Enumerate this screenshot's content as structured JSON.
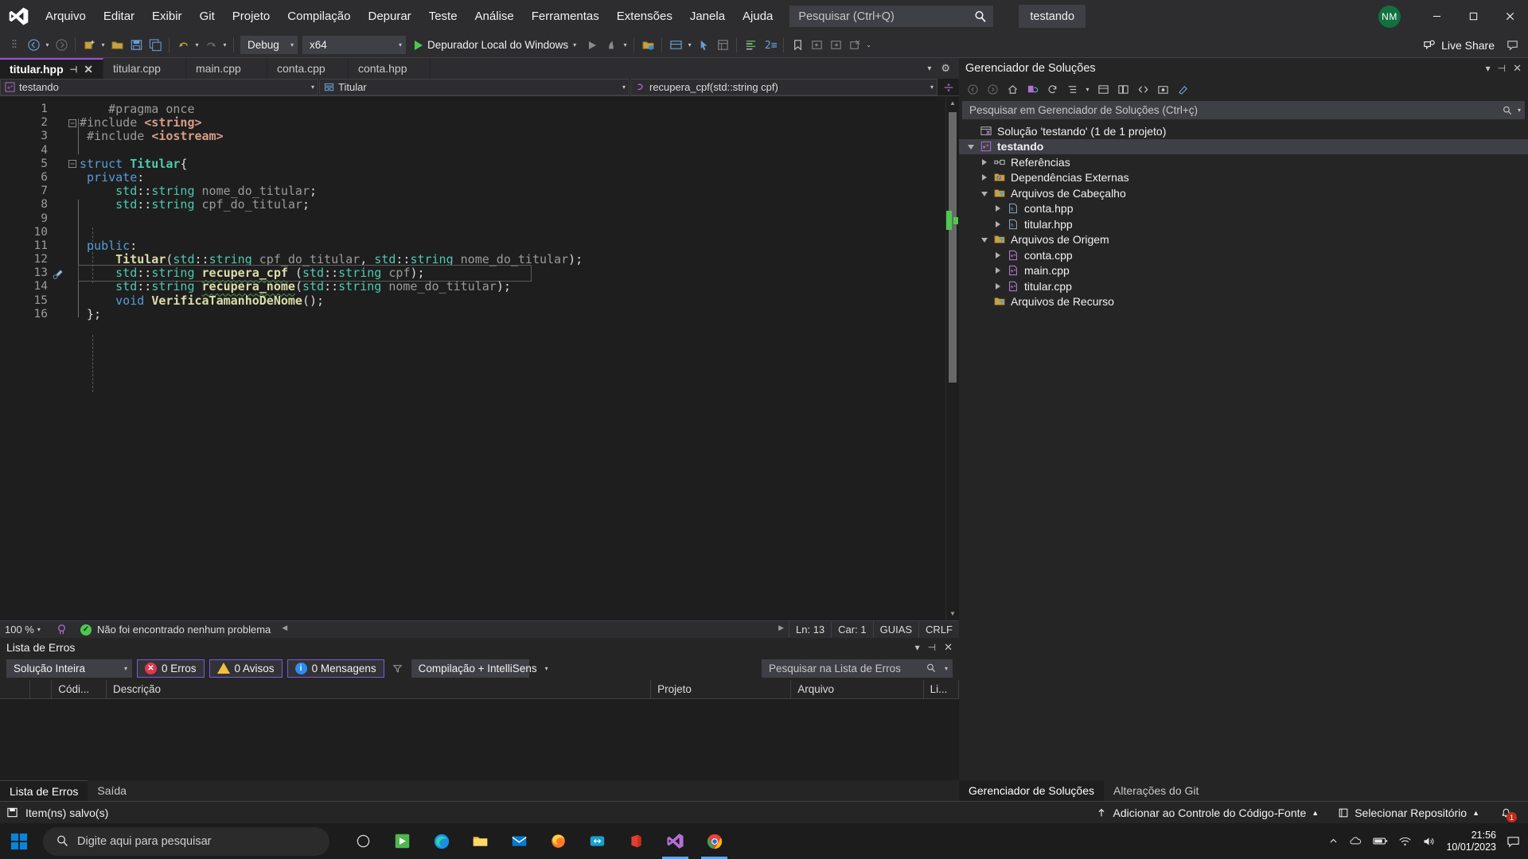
{
  "titlebar": {
    "logo_icon": "visual-studio-logo",
    "menus": [
      "Arquivo",
      "Editar",
      "Exibir",
      "Git",
      "Projeto",
      "Compilação",
      "Depurar",
      "Teste",
      "Análise",
      "Ferramentas",
      "Extensões",
      "Janela",
      "Ajuda"
    ],
    "search_placeholder": "Pesquisar (Ctrl+Q)",
    "search_icon": "search-icon",
    "solution_button": "testando",
    "avatar_initials": "NM",
    "minimize_icon": "minimize-icon",
    "maximize_icon": "maximize-icon",
    "close_icon": "close-icon"
  },
  "toolbar": {
    "config_value": "Debug",
    "platform_value": "x64",
    "run_label": "Depurador Local do Windows",
    "live_share_label": "Live Share",
    "icons": [
      "navigate-back-icon",
      "navigate-forward-icon",
      "new-project-icon",
      "open-file-icon",
      "save-icon",
      "save-all-icon",
      "undo-icon",
      "redo-icon"
    ]
  },
  "tabs": {
    "items": [
      {
        "label": "titular.hpp",
        "active": true
      },
      {
        "label": "titular.cpp",
        "active": false
      },
      {
        "label": "main.cpp",
        "active": false
      },
      {
        "label": "conta.cpp",
        "active": false
      },
      {
        "label": "conta.hpp",
        "active": false
      }
    ],
    "pin_icon": "pin-icon",
    "close_icon": "close-tab-icon",
    "overflow_icon": "tab-overflow-icon",
    "settings_icon": "gear-icon"
  },
  "navbar": {
    "project": "testando",
    "project_icon": "cpp-project-icon",
    "type": "Titular",
    "type_icon": "struct-icon",
    "member": "recupera_cpf(std::string cpf)",
    "member_icon": "method-icon",
    "split_icon": "split-editor-icon"
  },
  "code": {
    "lines": [
      {
        "n": "1",
        "fold": "",
        "text": "    #pragma once",
        "changed": false
      },
      {
        "n": "2",
        "fold": "-",
        "text": "#include <string>",
        "changed": false
      },
      {
        "n": "3",
        "fold": "",
        "text": " #include <iostream>",
        "changed": false
      },
      {
        "n": "4",
        "fold": "",
        "text": "",
        "changed": false
      },
      {
        "n": "5",
        "fold": "-",
        "text": "struct Titular{",
        "changed": false
      },
      {
        "n": "6",
        "fold": "",
        "text": " private:",
        "changed": false
      },
      {
        "n": "7",
        "fold": "",
        "text": "     std::string nome_do_titular;",
        "changed": false
      },
      {
        "n": "8",
        "fold": "",
        "text": "     std::string cpf_do_titular;",
        "changed": false
      },
      {
        "n": "9",
        "fold": "",
        "text": "",
        "changed": false
      },
      {
        "n": "10",
        "fold": "",
        "text": "",
        "changed": false
      },
      {
        "n": "11",
        "fold": "",
        "text": " public:",
        "changed": false
      },
      {
        "n": "12",
        "fold": "",
        "text": "     Titular(std::string cpf_do_titular, std::string nome_do_titular);",
        "changed": false
      },
      {
        "n": "13",
        "fold": "",
        "text": "     std::string recupera_cpf (std::string cpf);",
        "changed": true
      },
      {
        "n": "14",
        "fold": "",
        "text": "     std::string recupera_nome(std::string nome_do_titular);",
        "changed": true
      },
      {
        "n": "15",
        "fold": "",
        "text": "     void VerificaTamanhoDeNome();",
        "changed": false
      },
      {
        "n": "16",
        "fold": "",
        "text": " };",
        "changed": false
      }
    ],
    "current_line": 13,
    "lightbulb_icon": "quick-actions-screwdriver-icon"
  },
  "editor_status": {
    "zoom": "100 %",
    "intellicode_icon": "intellicode-icon",
    "problems_icon": "check-circle-icon",
    "problems_text": "Não foi encontrado nenhum problema",
    "line_label": "Ln: 13",
    "col_label": "Car: 1",
    "guides_label": "GUIAS",
    "eol_label": "CRLF"
  },
  "error_list": {
    "title": "Lista de Erros",
    "pin_icon": "pin-icon",
    "close_icon": "close-icon",
    "dropdown_icon": "chevron-down-icon",
    "scope": "Solução Inteira",
    "errors": "0 Erros",
    "warnings": "0 Avisos",
    "messages": "0 Mensagens",
    "filter_icon": "filter-icon",
    "build_filter": "Compilação + IntelliSens",
    "search_placeholder": "Pesquisar na Lista de Erros",
    "search_icon": "search-icon",
    "columns": [
      "",
      "",
      "Códi...",
      "Descrição",
      "Projeto",
      "Arquivo",
      "Li..."
    ],
    "tabs": [
      {
        "label": "Lista de Erros",
        "active": true
      },
      {
        "label": "Saída",
        "active": false
      }
    ]
  },
  "solution_explorer": {
    "title": "Gerenciador de Soluções",
    "dropdown_icon": "chevron-down-icon",
    "pin_icon": "pin-icon",
    "close_icon": "close-icon",
    "toolbar_icons": [
      "back-icon",
      "forward-icon",
      "home-icon",
      "sync-with-active-document-icon",
      "refresh-icon",
      "collapse-all-icon",
      "show-all-files-icon",
      "properties-icon",
      "code-view-icon",
      "preview-selected-items-icon",
      "pending-changes-icon"
    ],
    "search_placeholder": "Pesquisar em Gerenciador de Soluções (Ctrl+ç)",
    "search_icon": "search-icon",
    "search_dropdown_icon": "chevron-down-icon",
    "tree": [
      {
        "label": "Solução 'testando' (1 de 1 projeto)",
        "depth": 0,
        "twisty": "none",
        "icon": "solution-icon",
        "bold": false,
        "selected": false
      },
      {
        "label": "testando",
        "depth": 0,
        "twisty": "open",
        "icon": "cpp-project-icon",
        "bold": true,
        "selected": true
      },
      {
        "label": "Referências",
        "depth": 1,
        "twisty": "closed",
        "icon": "references-icon",
        "bold": false,
        "selected": false
      },
      {
        "label": "Dependências Externas",
        "depth": 1,
        "twisty": "closed",
        "icon": "ext-deps-folder-icon",
        "bold": false,
        "selected": false
      },
      {
        "label": "Arquivos de Cabeçalho",
        "depth": 1,
        "twisty": "open",
        "icon": "filter-folder-icon",
        "bold": false,
        "selected": false
      },
      {
        "label": "conta.hpp",
        "depth": 2,
        "twisty": "closed",
        "icon": "hpp-file-icon",
        "bold": false,
        "selected": false
      },
      {
        "label": "titular.hpp",
        "depth": 2,
        "twisty": "closed",
        "icon": "hpp-file-icon",
        "bold": false,
        "selected": false
      },
      {
        "label": "Arquivos de Origem",
        "depth": 1,
        "twisty": "open",
        "icon": "filter-folder-icon",
        "bold": false,
        "selected": false
      },
      {
        "label": "conta.cpp",
        "depth": 2,
        "twisty": "closed",
        "icon": "cpp-file-icon",
        "bold": false,
        "selected": false
      },
      {
        "label": "main.cpp",
        "depth": 2,
        "twisty": "closed",
        "icon": "cpp-file-icon",
        "bold": false,
        "selected": false
      },
      {
        "label": "titular.cpp",
        "depth": 2,
        "twisty": "closed",
        "icon": "cpp-file-icon",
        "bold": false,
        "selected": false
      },
      {
        "label": "Arquivos de Recurso",
        "depth": 1,
        "twisty": "none",
        "icon": "filter-folder-icon",
        "bold": false,
        "selected": false
      }
    ],
    "bottom_tabs": [
      {
        "label": "Gerenciador de Soluções",
        "active": true
      },
      {
        "label": "Alterações do Git",
        "active": false
      }
    ]
  },
  "statusbar": {
    "save_icon": "save-status-icon",
    "save_text": "Item(ns) salvo(s)",
    "source_control_icon": "upload-arrow-icon",
    "source_control_text": "Adicionar ao Controle do Código-Fonte",
    "source_control_caret": "chevron-up-icon",
    "repo_icon": "repository-icon",
    "repo_text": "Selecionar Repositório",
    "repo_caret": "chevron-up-icon",
    "notification_icon": "bell-icon",
    "notification_count": "1"
  },
  "taskbar": {
    "start_icon": "windows-start-icon",
    "search_placeholder": "Digite aqui para pesquisar",
    "search_icon": "search-icon",
    "apps": [
      {
        "name": "cortana-icon",
        "active": false
      },
      {
        "name": "microsoft-store-icon",
        "active": false
      },
      {
        "name": "edge-icon",
        "active": false
      },
      {
        "name": "file-explorer-icon",
        "active": false
      },
      {
        "name": "mail-icon",
        "active": false
      },
      {
        "name": "firefox-icon",
        "active": false
      },
      {
        "name": "link-app-icon",
        "active": false
      },
      {
        "name": "office-icon",
        "active": false
      },
      {
        "name": "visual-studio-icon",
        "active": true
      },
      {
        "name": "chrome-icon",
        "active": true
      }
    ],
    "tray_icons": [
      "show-hidden-icons-chevron",
      "onedrive-icon",
      "battery-icon",
      "wifi-icon",
      "volume-icon"
    ],
    "clock_time": "21:56",
    "clock_date": "10/01/2023",
    "notification_center_icon": "action-center-icon"
  },
  "colors": {
    "accent_purple": "#9b4fd4",
    "chrome_bg": "#2d2d30",
    "editor_bg": "#1e1e1e",
    "panel_bg": "#252526",
    "change_green": "#3fae3f",
    "error_red": "#e0384c",
    "warning_yellow": "#f0c040",
    "info_blue": "#2d8cf0",
    "avatar_green": "#13703f"
  }
}
